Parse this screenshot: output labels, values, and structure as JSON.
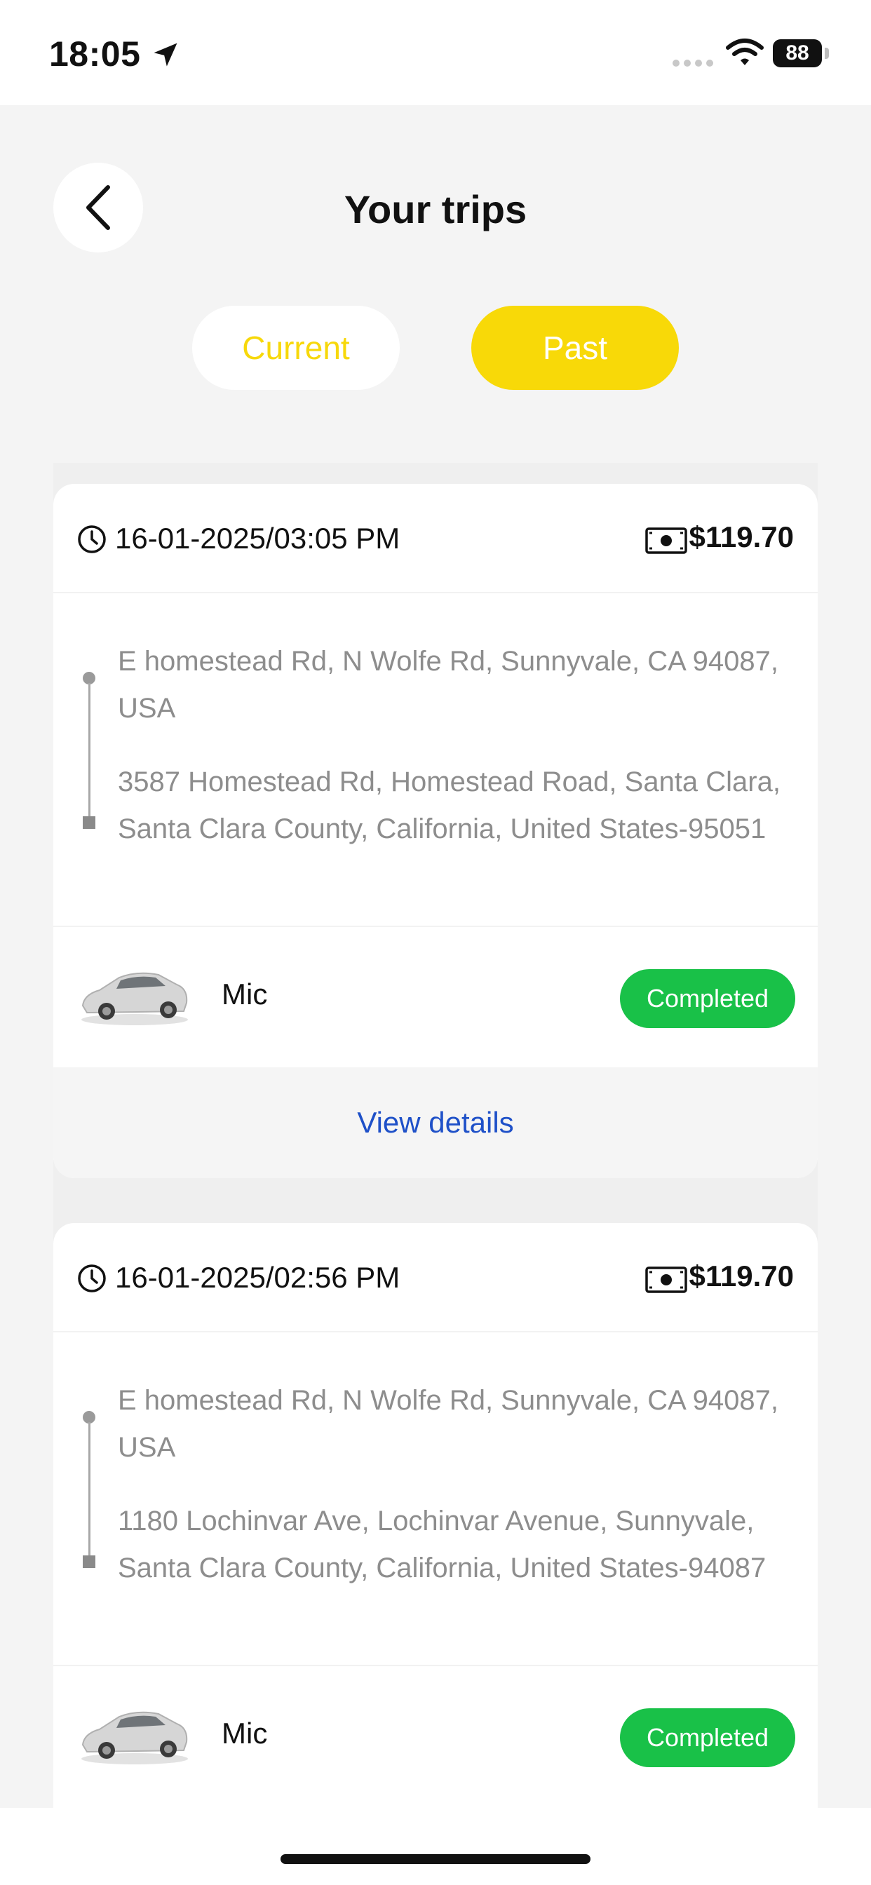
{
  "status_bar": {
    "time": "18:05",
    "battery": "88",
    "icons": [
      "location-arrow-icon",
      "signal-icon",
      "wifi-icon",
      "battery-icon"
    ]
  },
  "header": {
    "title": "Your trips",
    "back_icon": "chevron-left-icon"
  },
  "tabs": [
    {
      "label": "Current",
      "selected": false
    },
    {
      "label": "Past",
      "selected": true
    }
  ],
  "colors": {
    "accent": "#f8d908",
    "status_completed": "#19c148",
    "link": "#1e50c8",
    "address_text": "#8d8d8d"
  },
  "trips": [
    {
      "datetime": "16-01-2025/03:05 PM",
      "price": "$119.70",
      "pickup": "E homestead Rd, N Wolfe Rd, Sunnyvale, CA 94087, USA",
      "dropoff": "3587 Homestead Rd, Homestead Road, Santa Clara, Santa Clara County, California, United States-95051",
      "driver": "Mic",
      "status": "Completed",
      "action": "View details"
    },
    {
      "datetime": "16-01-2025/02:56 PM",
      "price": "$119.70",
      "pickup": "E homestead Rd, N Wolfe Rd, Sunnyvale, CA 94087, USA",
      "dropoff": "1180 Lochinvar Ave, Lochinvar Avenue, Sunnyvale, Santa Clara County, California, United States-94087",
      "driver": "Mic",
      "status": "Completed"
    }
  ]
}
